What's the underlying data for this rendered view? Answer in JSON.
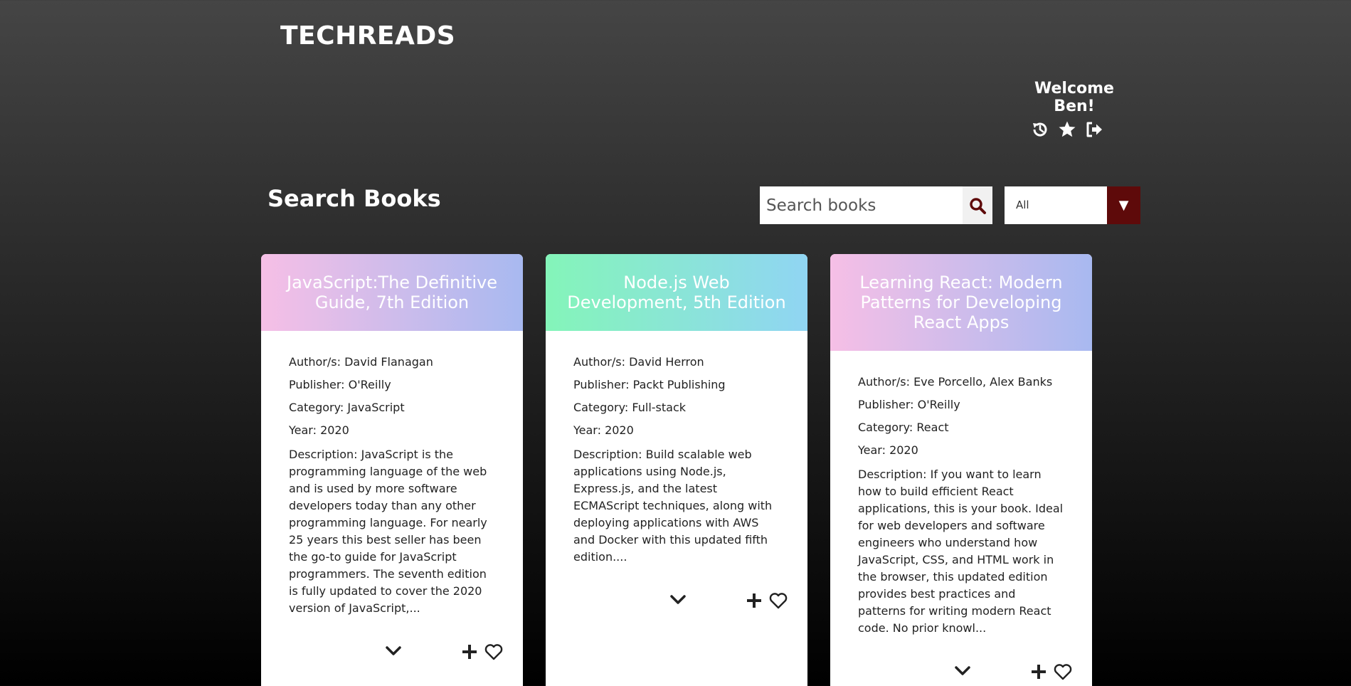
{
  "header": {
    "logo": "TECHREADS",
    "welcome": "Welcome Ben!",
    "icons": [
      "history-icon",
      "star-icon",
      "sign-out-icon"
    ]
  },
  "search": {
    "title": "Search Books",
    "placeholder": "Search books",
    "filter_value": "All",
    "accent_color": "#5e0a0a"
  },
  "books": [
    {
      "title": "JavaScript:The Definitive Guide, 7th Edition",
      "author": "Author/s: David Flanagan",
      "publisher": "Publisher: O'Reilly",
      "category": "Category: JavaScript",
      "year": "Year: 2020",
      "description": "Description: JavaScript is the programming language of the web and is used by more software developers today than any other programming language. For nearly 25 years this best seller has been the go-to guide for JavaScript programmers. The seventh edition is fully updated to cover the 2020 version of JavaScript,...",
      "header_gradient": [
        "#f6bfe6",
        "#a8b9f0"
      ]
    },
    {
      "title": "Node.js Web Development, 5th Edition",
      "author": "Author/s: David Herron",
      "publisher": "Publisher: Packt Publishing",
      "category": "Category: Full-stack",
      "year": "Year: 2020",
      "description": "Description: Build scalable web applications using Node.js, Express.js, and the latest ECMAScript techniques, along with deploying applications with AWS and Docker with this updated fifth edition....",
      "header_gradient": [
        "#84f5b9",
        "#90d5f3"
      ]
    },
    {
      "title": "Learning React: Modern Patterns for Developing React Apps",
      "author": "Author/s: Eve Porcello, Alex Banks",
      "publisher": "Publisher: O'Reilly",
      "category": "Category: React",
      "year": "Year: 2020",
      "description": "Description: If you want to learn how to build efficient React applications, this is your book. Ideal for web developers and software engineers who understand how JavaScript, CSS, and HTML work in the browser, this updated edition provides best practices and patterns for writing modern React code. No prior knowl...",
      "header_gradient": [
        "#f6bfe6",
        "#a8b9f0"
      ]
    }
  ]
}
